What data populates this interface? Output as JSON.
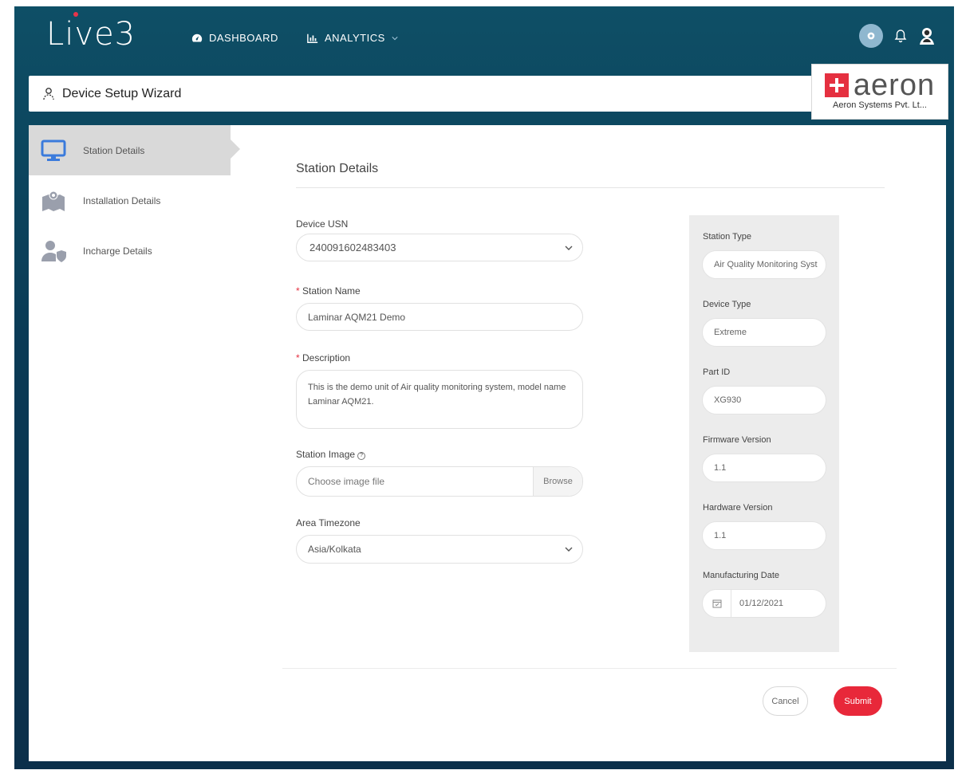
{
  "app": {
    "logo": "Live3"
  },
  "nav": {
    "dashboard": "DASHBOARD",
    "analytics": "ANALYTICS"
  },
  "wizard": {
    "title": "Device Setup Wizard"
  },
  "brand": {
    "name": "aeron",
    "company": "Aeron Systems Pvt. Lt..."
  },
  "sidebar": {
    "items": [
      {
        "label": "Station Details",
        "icon": "monitor-icon",
        "active": true
      },
      {
        "label": "Installation Details",
        "icon": "map-icon",
        "active": false
      },
      {
        "label": "Incharge Details",
        "icon": "user-shield-icon",
        "active": false
      }
    ]
  },
  "form": {
    "section_title": "Station Details",
    "device_usn": {
      "label": "Device USN",
      "value": "240091602483403"
    },
    "station_name": {
      "label": "Station Name",
      "value": "Laminar AQM21 Demo"
    },
    "description": {
      "label": "Description",
      "value": "This is the demo unit of Air quality monitoring system, model name Laminar AQM21."
    },
    "station_image": {
      "label": "Station Image",
      "placeholder": "Choose image file",
      "browse": "Browse"
    },
    "timezone": {
      "label": "Area Timezone",
      "value": "Asia/Kolkata"
    }
  },
  "details": {
    "station_type": {
      "label": "Station Type",
      "value": "Air Quality Monitoring Syst"
    },
    "device_type": {
      "label": "Device Type",
      "value": "Extreme"
    },
    "part_id": {
      "label": "Part ID",
      "value": "XG930"
    },
    "firmware_version": {
      "label": "Firmware Version",
      "value": "1.1"
    },
    "hardware_version": {
      "label": "Hardware Version",
      "value": "1.1"
    },
    "manufacturing_date": {
      "label": "Manufacturing Date",
      "value": "01/12/2021"
    }
  },
  "actions": {
    "cancel": "Cancel",
    "submit": "Submit"
  },
  "colors": {
    "accent": "#e8283a",
    "header_bg": "#0e4f66",
    "active_side": "#d9d9d9"
  }
}
